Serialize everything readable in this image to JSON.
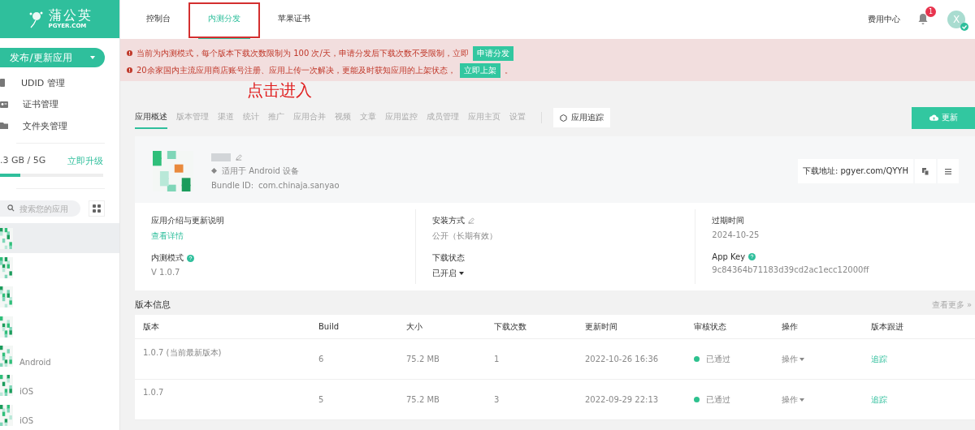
{
  "sidebar": {
    "logo": {
      "name": "蒲公英",
      "domain": "PGYER.COM"
    },
    "publish_button": "发布/更新应用",
    "menu": [
      {
        "label": "UDID 管理",
        "kind": "device"
      },
      {
        "label": "证书管理",
        "kind": "card"
      },
      {
        "label": "文件夹管理",
        "kind": "folder"
      }
    ],
    "storage": {
      "usage": ".3 GB / 5G",
      "upgrade": "立即升级",
      "level": 0.2
    },
    "search": {
      "placeholder": "搜索您的应用"
    },
    "apps": [
      {
        "selected": true
      },
      {
        "selected": false
      },
      {
        "selected": false
      },
      {
        "selected": false
      },
      {
        "selected": false,
        "platform": "Android"
      },
      {
        "selected": false,
        "platform": "iOS"
      },
      {
        "selected": false,
        "platform": "iOS"
      }
    ]
  },
  "top_nav": {
    "tabs": [
      {
        "label": "控制台",
        "selected": false
      },
      {
        "label": "内测分发",
        "selected": true
      },
      {
        "label": "苹果证书",
        "selected": false
      }
    ],
    "billing": "费用中心",
    "notification_count": "1",
    "avatar": "X"
  },
  "alerts": [
    {
      "text": "当前为内测模式，每个版本下载次数限制为 100 次/天，申请分发后下载次数不受限制，立即",
      "action": "申请分发"
    },
    {
      "text": "20余家国内主流应用商店账号注册、应用上传一次解决，更能及时获知应用的上架状态，",
      "action": "立即上架",
      "suffix": "。"
    }
  ],
  "annotation": {
    "text": "点击进入"
  },
  "app_tabs": [
    {
      "label": "应用概述",
      "selected": true
    },
    {
      "label": "版本管理",
      "selected": false
    },
    {
      "label": "渠道",
      "selected": false
    },
    {
      "label": "统计",
      "selected": false
    },
    {
      "label": "推广",
      "selected": false
    },
    {
      "label": "应用合并",
      "selected": false
    },
    {
      "label": "视频",
      "selected": false
    },
    {
      "label": "文章",
      "selected": false
    },
    {
      "label": "应用监控",
      "selected": false
    },
    {
      "label": "成员管理",
      "selected": false
    },
    {
      "label": "应用主页",
      "selected": false
    },
    {
      "label": "设置",
      "selected": false
    }
  ],
  "track_button": "应用追踪",
  "update_button": "更新",
  "app": {
    "platform": "适用于 Android 设备",
    "bundle_label": "Bundle ID:",
    "bundle_id": "com.chinaja.sanyao",
    "download": "下载地址: pgyer.com/QYYH"
  },
  "info": [
    {
      "label": "应用介绍与更新说明",
      "value": "查看详情",
      "kind": "link"
    },
    {
      "label": "安装方式",
      "value": "公开（长期有效）",
      "kind": "editable"
    },
    {
      "label": "过期时间",
      "value": "2024-10-25",
      "kind": "plain"
    },
    {
      "label": "内测模式",
      "value": "V 1.0.7",
      "kind": "help"
    },
    {
      "label": "下载状态",
      "value": "已开启",
      "kind": "dropdown"
    },
    {
      "label": "App Key",
      "value": "9c84364b71183d39cd2ac1ecc12000ff",
      "kind": "help"
    }
  ],
  "versions": {
    "title": "版本信息",
    "more": "查看更多 »",
    "columns": [
      "版本",
      "Build",
      "大小",
      "下载次数",
      "更新时间",
      "审核状态",
      "操作",
      "版本跟进"
    ],
    "rows": [
      {
        "version": "1.0.7 (当前最新版本)",
        "build": "6",
        "size": "75.2 MB",
        "downloads": "1",
        "updated": "2022-10-26 16:36",
        "status": "已通过",
        "color": "#2dc18e",
        "action": "操作",
        "follow": "追踪"
      },
      {
        "version": "1.0.7",
        "build": "5",
        "size": "75.2 MB",
        "downloads": "3",
        "updated": "2022-09-29 22:13",
        "status": "已通过",
        "color": "#2dc18e",
        "action": "操作",
        "follow": "追踪"
      }
    ]
  }
}
